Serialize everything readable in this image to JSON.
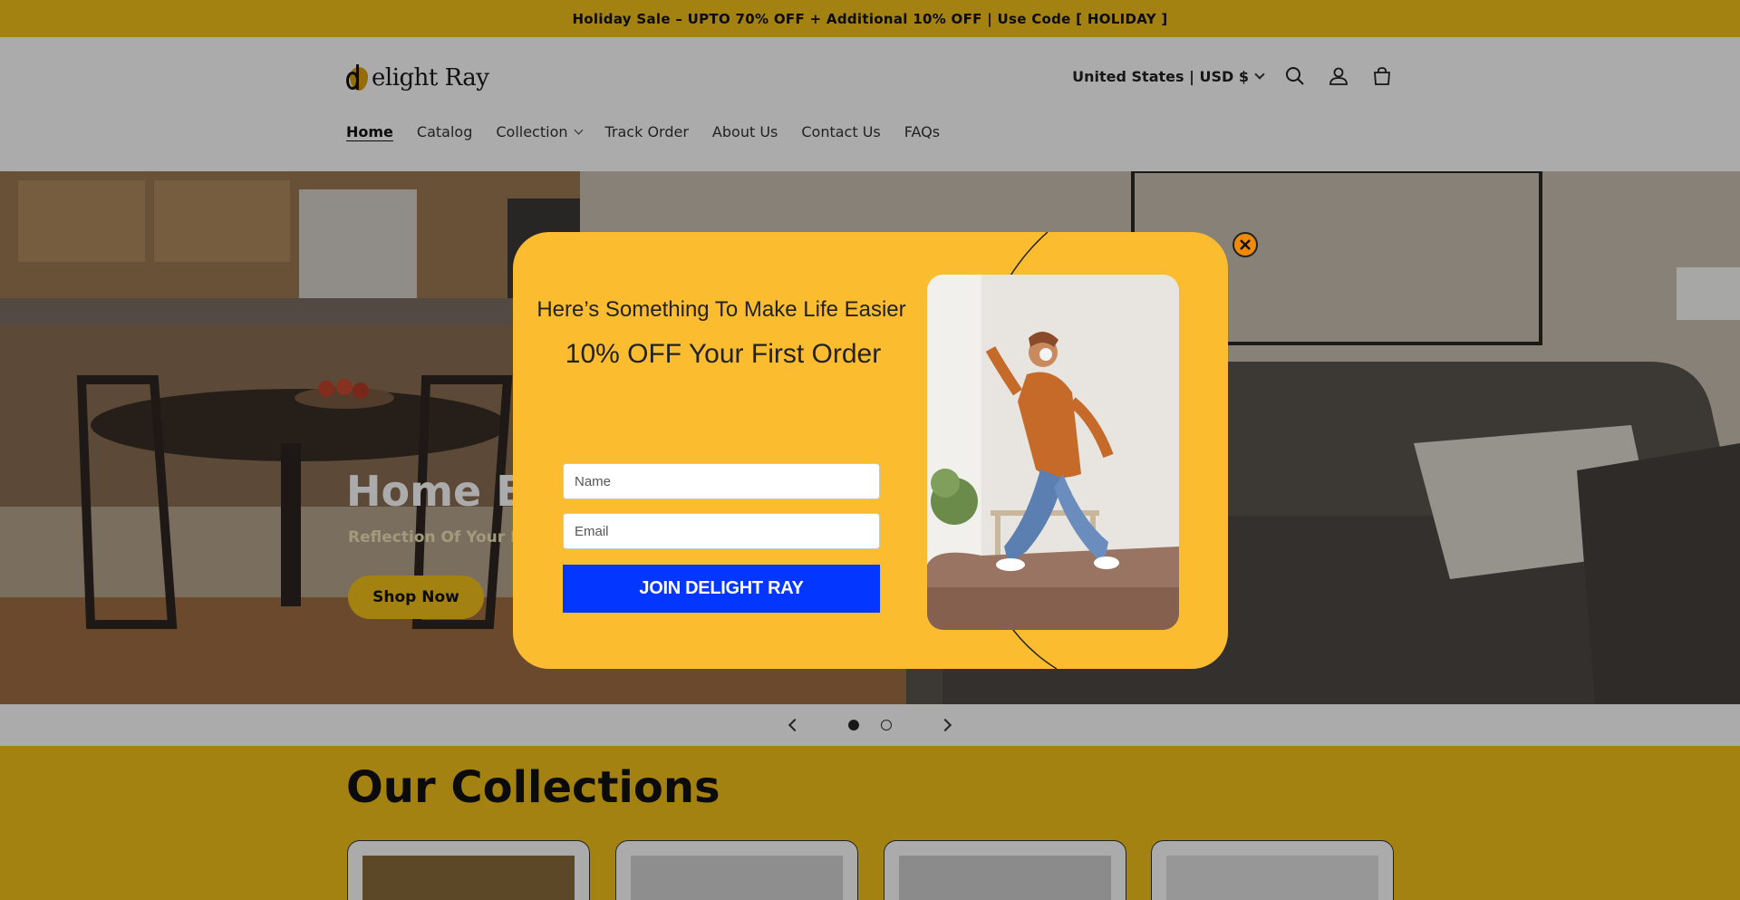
{
  "announcement": "Holiday Sale – UPTO 70% OFF + Additional 10% OFF | Use Code [ HOLIDAY ]",
  "header": {
    "logo_text": "elight Ray",
    "locale": "United States | USD $",
    "icons": [
      "search-icon",
      "account-icon",
      "cart-icon"
    ]
  },
  "nav": {
    "items": [
      {
        "label": "Home"
      },
      {
        "label": "Catalog"
      },
      {
        "label": "Collection"
      },
      {
        "label": "Track Order"
      },
      {
        "label": "About Us"
      },
      {
        "label": "Contact Us"
      },
      {
        "label": "FAQs"
      }
    ]
  },
  "hero": {
    "title": "Home Es",
    "subtitle": "Reflection Of Your D",
    "button": "Shop Now"
  },
  "slider": {
    "current": 1,
    "total": 2
  },
  "collections": {
    "title": "Our Collections"
  },
  "popup": {
    "headline": "Here’s Something To Make Life Easier",
    "offer": "10% OFF Your First Order",
    "name_placeholder": "Name",
    "email_placeholder": "Email",
    "button": "JOIN DELIGHT RAY"
  },
  "colors": {
    "brand_yellow": "#f4c21a",
    "popup_bg": "#fbbd2f",
    "popup_button": "#0336ff",
    "close_button": "#f08a08"
  }
}
